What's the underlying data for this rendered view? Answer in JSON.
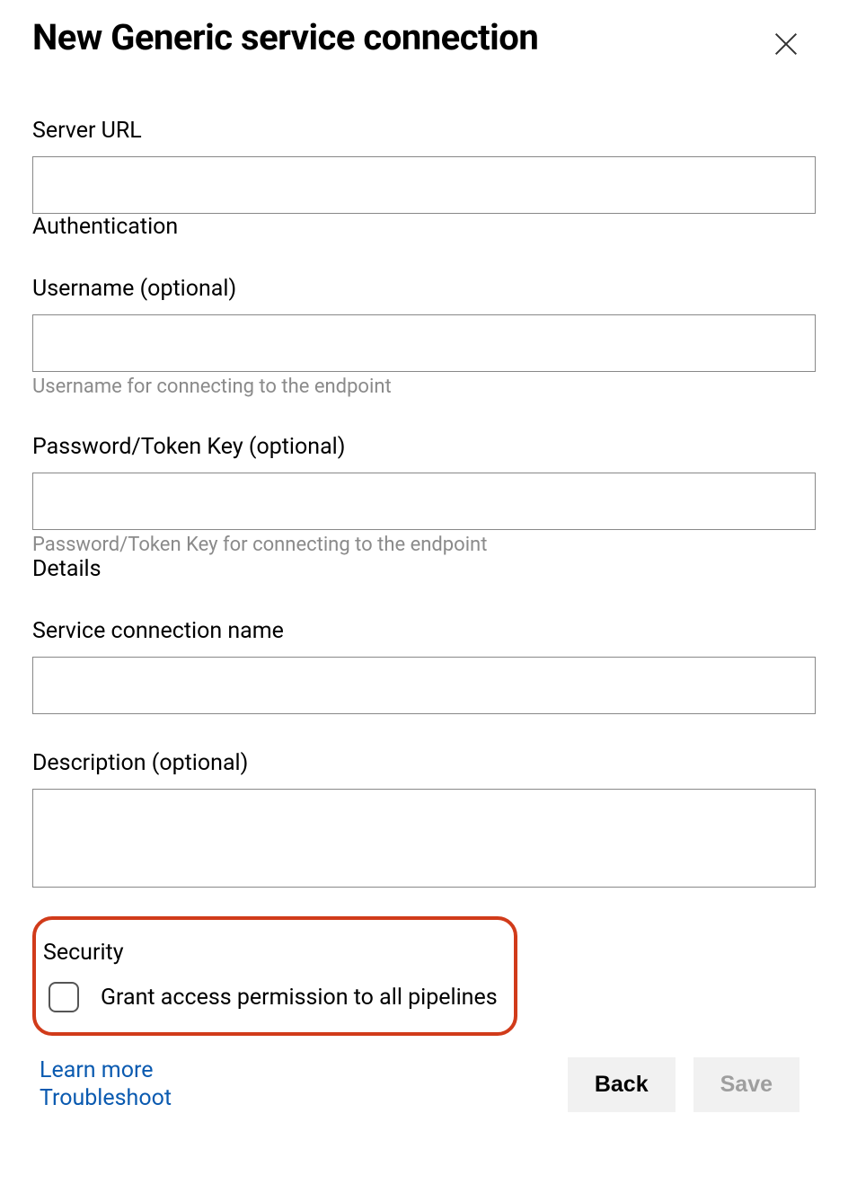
{
  "dialog": {
    "title": "New Generic service connection"
  },
  "fields": {
    "server_url": {
      "label": "Server URL",
      "value": ""
    }
  },
  "auth_section": {
    "heading": "Authentication",
    "username": {
      "label": "Username (optional)",
      "value": "",
      "helper": "Username for connecting to the endpoint"
    },
    "password": {
      "label": "Password/Token Key (optional)",
      "value": "",
      "helper": "Password/Token Key for connecting to the endpoint"
    }
  },
  "details_section": {
    "heading": "Details",
    "name": {
      "label": "Service connection name",
      "value": ""
    },
    "description": {
      "label": "Description (optional)",
      "value": ""
    }
  },
  "security_section": {
    "heading": "Security",
    "grant_access": {
      "label": "Grant access permission to all pipelines",
      "checked": false
    }
  },
  "footer": {
    "learn_more": "Learn more",
    "troubleshoot": "Troubleshoot",
    "back": "Back",
    "save": "Save"
  }
}
